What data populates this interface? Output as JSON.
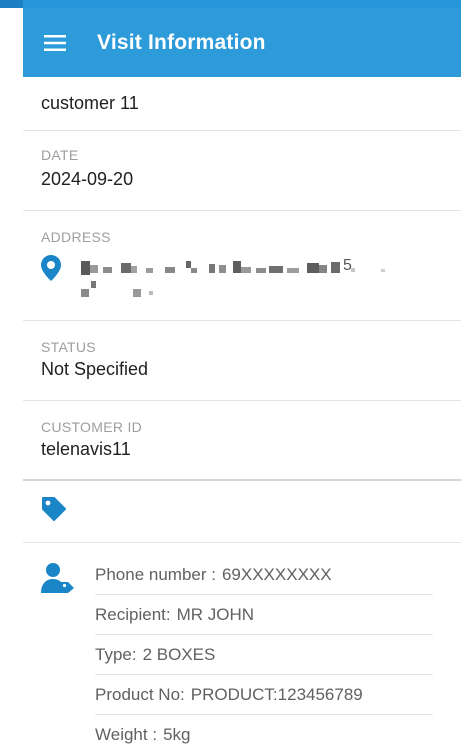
{
  "app_bar": {
    "title": "Visit Information",
    "menu_icon": "hamburger-menu-icon",
    "color": "#2d9ad9"
  },
  "visit": {
    "customer_name": "customer 11",
    "date_label": "DATE",
    "date_value": "2024-09-20",
    "address_label": "ADDRESS",
    "address_icon": "map-pin-icon",
    "address_visible_suffix": "5",
    "status_label": "STATUS",
    "status_value": "Not Specified",
    "customer_id_label": "CUSTOMER ID",
    "customer_id_value": "telenavis11",
    "tag_icon": "tag-icon",
    "details_icon": "recipient-person-icon",
    "accent_color": "#1a86c7"
  },
  "details": [
    {
      "key": "Phone number :",
      "value": "69XXXXXXXX"
    },
    {
      "key": "Recipient:",
      "value": "MR JOHN"
    },
    {
      "key": "Type:",
      "value": "2 BOXES"
    },
    {
      "key": "Product No:",
      "value": "PRODUCT:123456789"
    },
    {
      "key": "Weight :",
      "value": "5kg"
    }
  ]
}
